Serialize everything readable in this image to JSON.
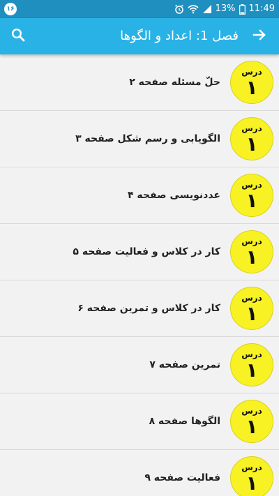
{
  "status_bar": {
    "notification_badge": "۱۶",
    "battery": "13%",
    "time": "11:49",
    "icons": [
      "alarm-icon",
      "wifi-icon",
      "signal-icon",
      "battery-icon"
    ]
  },
  "app_bar": {
    "title": "فصل 1: اعداد و الگوها",
    "back_icon": "arrow-right-icon",
    "search_icon": "search-icon",
    "background_color": "#29b2e6"
  },
  "lessons": [
    {
      "badge_label": "درس",
      "badge_number": "۱",
      "title": "حلّ مسئله صفحه ۲"
    },
    {
      "badge_label": "درس",
      "badge_number": "۱",
      "title": "الگویابی و رسم شکل صفحه ۳"
    },
    {
      "badge_label": "درس",
      "badge_number": "۱",
      "title": "عددنویسی صفحه ۴"
    },
    {
      "badge_label": "درس",
      "badge_number": "۱",
      "title": "کار در کلاس و فعالیت صفحه ۵"
    },
    {
      "badge_label": "درس",
      "badge_number": "۱",
      "title": "کار در کلاس و تمرین صفحه ۶"
    },
    {
      "badge_label": "درس",
      "badge_number": "۱",
      "title": "تمرین صفحه ۷"
    },
    {
      "badge_label": "درس",
      "badge_number": "۱",
      "title": "الگوها صفحه ۸"
    },
    {
      "badge_label": "درس",
      "badge_number": "۱",
      "title": "فعالیت صفحه ۹"
    }
  ],
  "colors": {
    "badge": "#f8f224",
    "status_bar": "#1f8fbf",
    "list_background": "#f2f2f2"
  }
}
